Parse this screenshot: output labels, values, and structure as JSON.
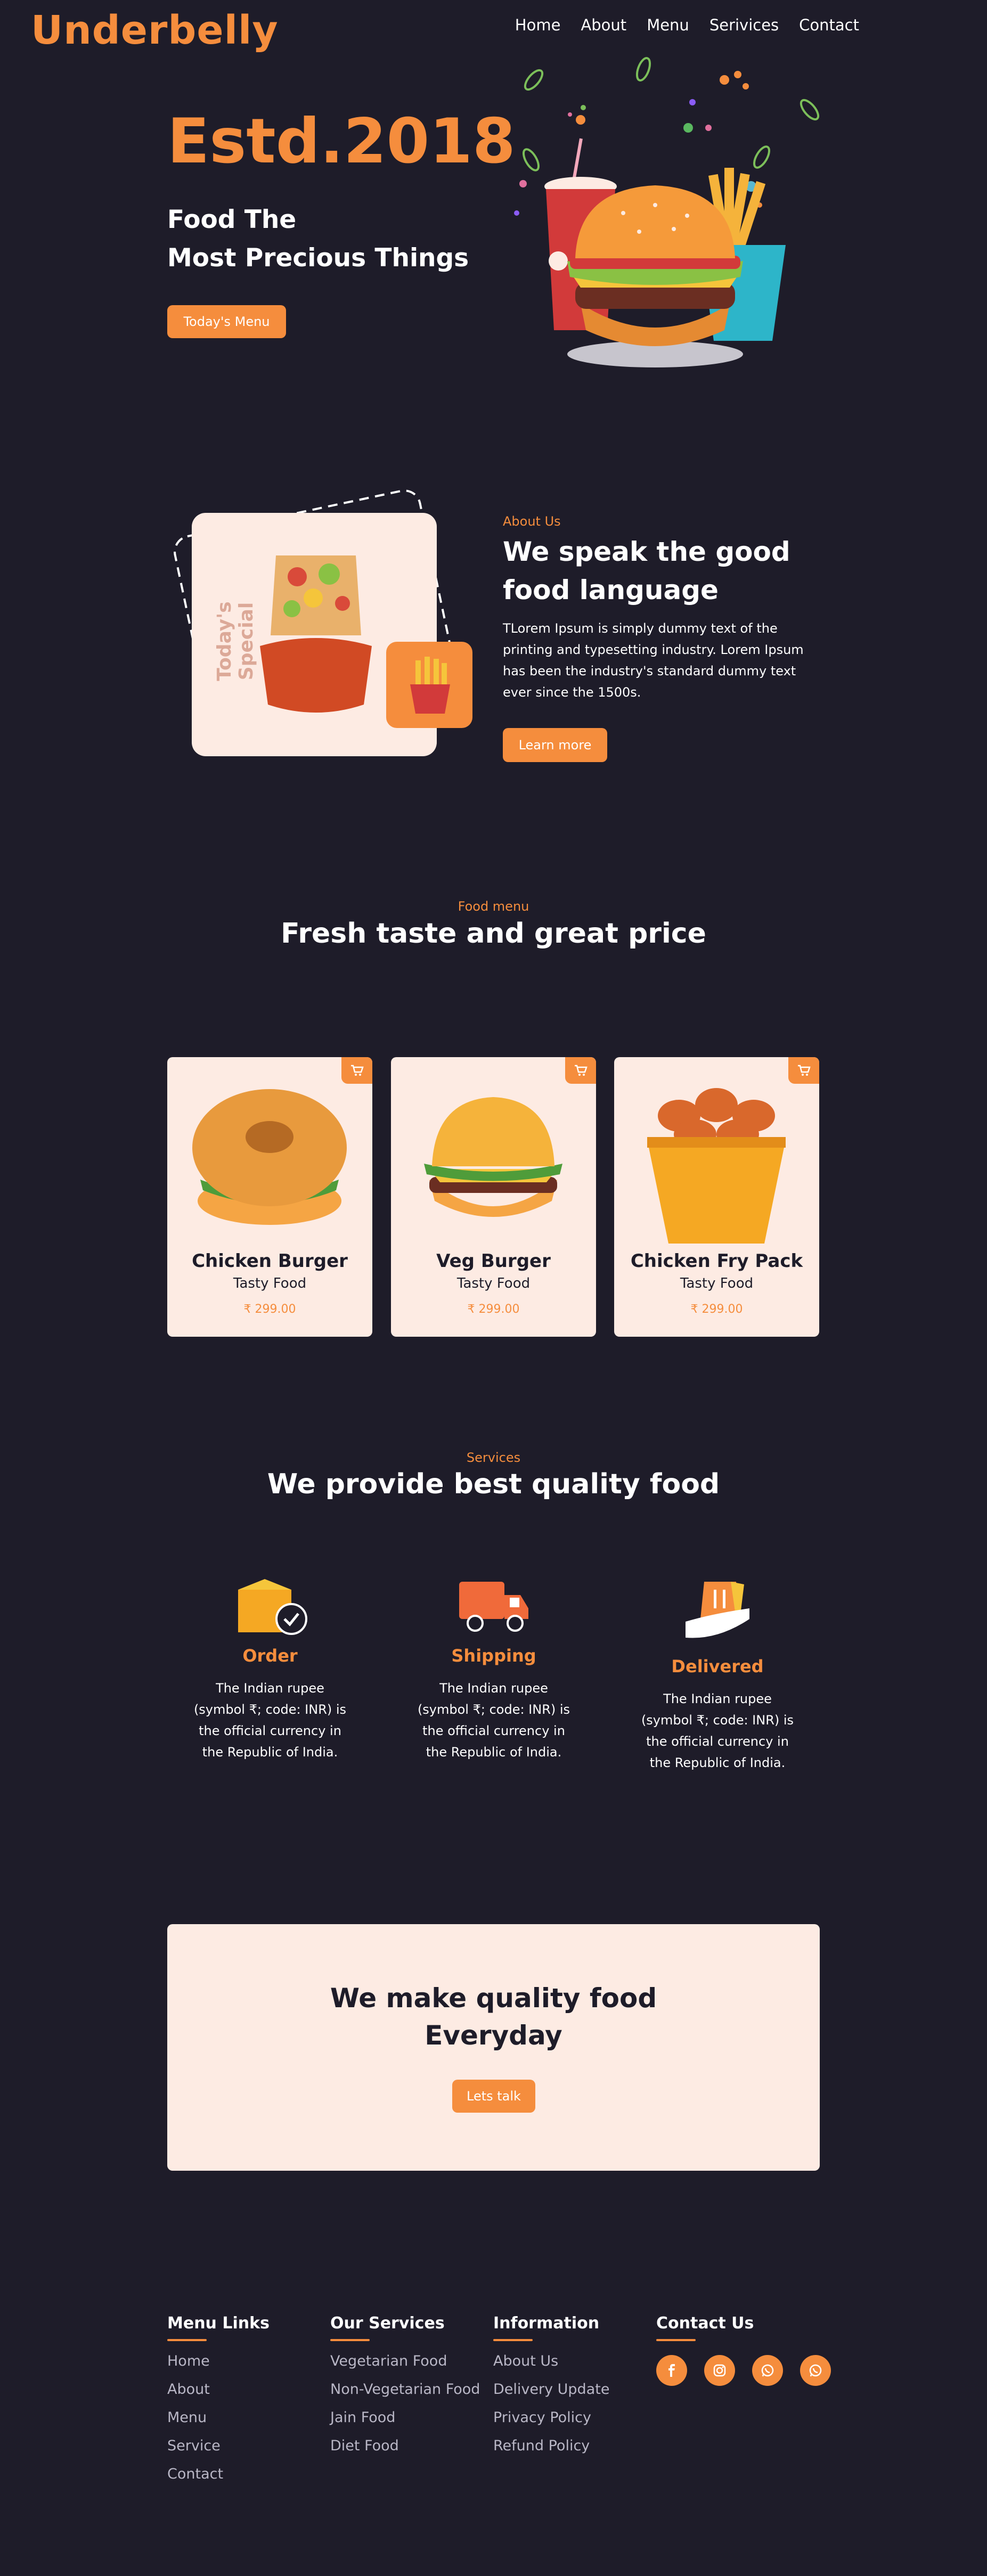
{
  "header": {
    "logo": "Underbelly",
    "nav": [
      "Home",
      "About",
      "Menu",
      "Serivices",
      "Contact"
    ]
  },
  "hero": {
    "year": "Estd.2018",
    "line1": "Food The",
    "line2": "Most Precious Things",
    "button": "Today's Menu"
  },
  "about": {
    "card_label": "Today's Special",
    "tag": "About Us",
    "heading_line1": "We speak the good",
    "heading_line2": "food language",
    "paragraph": "TLorem Ipsum is simply dummy text of the printing and typesetting industry. Lorem Ipsum has been the industry's standard dummy text ever since the 1500s.",
    "button": "Learn more"
  },
  "menu": {
    "tag": "Food menu",
    "heading": "Fresh taste and great price",
    "items": [
      {
        "name": "Chicken Burger",
        "sub": "Tasty Food",
        "price": "₹ 299.00"
      },
      {
        "name": "Veg Burger",
        "sub": "Tasty Food",
        "price": "₹ 299.00"
      },
      {
        "name": "Chicken Fry Pack",
        "sub": "Tasty Food",
        "price": "₹ 299.00"
      }
    ]
  },
  "services": {
    "tag": "Services",
    "heading": "We provide best quality food",
    "items": [
      {
        "title": "Order",
        "desc_lines": [
          "The Indian rupee",
          "(symbol ₹; code: INR) is",
          "the official currency in",
          "the Republic of India."
        ]
      },
      {
        "title": "Shipping",
        "desc_lines": [
          "The Indian rupee",
          "(symbol ₹; code: INR) is",
          "the official currency in",
          "the Republic of India."
        ]
      },
      {
        "title": "Delivered",
        "desc_lines": [
          "The Indian rupee",
          "(symbol ₹; code: INR) is",
          "the official currency in",
          "the Republic of India."
        ]
      }
    ]
  },
  "cta": {
    "line1": "We make quality food",
    "line2": "Everyday",
    "button": "Lets talk"
  },
  "footer": {
    "menu_links": {
      "title": "Menu Links",
      "links": [
        "Home",
        "About",
        "Menu",
        "Service",
        "Contact"
      ]
    },
    "our_services": {
      "title": "Our Services",
      "links": [
        "Vegetarian Food",
        "Non-Vegetarian Food",
        "Jain Food",
        "Diet Food"
      ]
    },
    "information": {
      "title": "Information",
      "links": [
        "About Us",
        "Delivery Update",
        "Privacy Policy",
        "Refund Policy"
      ]
    },
    "contact": {
      "title": "Contact Us",
      "social_icons": [
        "facebook-icon",
        "instagram-icon",
        "whatsapp-icon",
        "whatsapp-icon"
      ]
    }
  },
  "colors": {
    "accent": "#f58d3d",
    "background": "#1e1c29",
    "card": "#fdebe3"
  }
}
